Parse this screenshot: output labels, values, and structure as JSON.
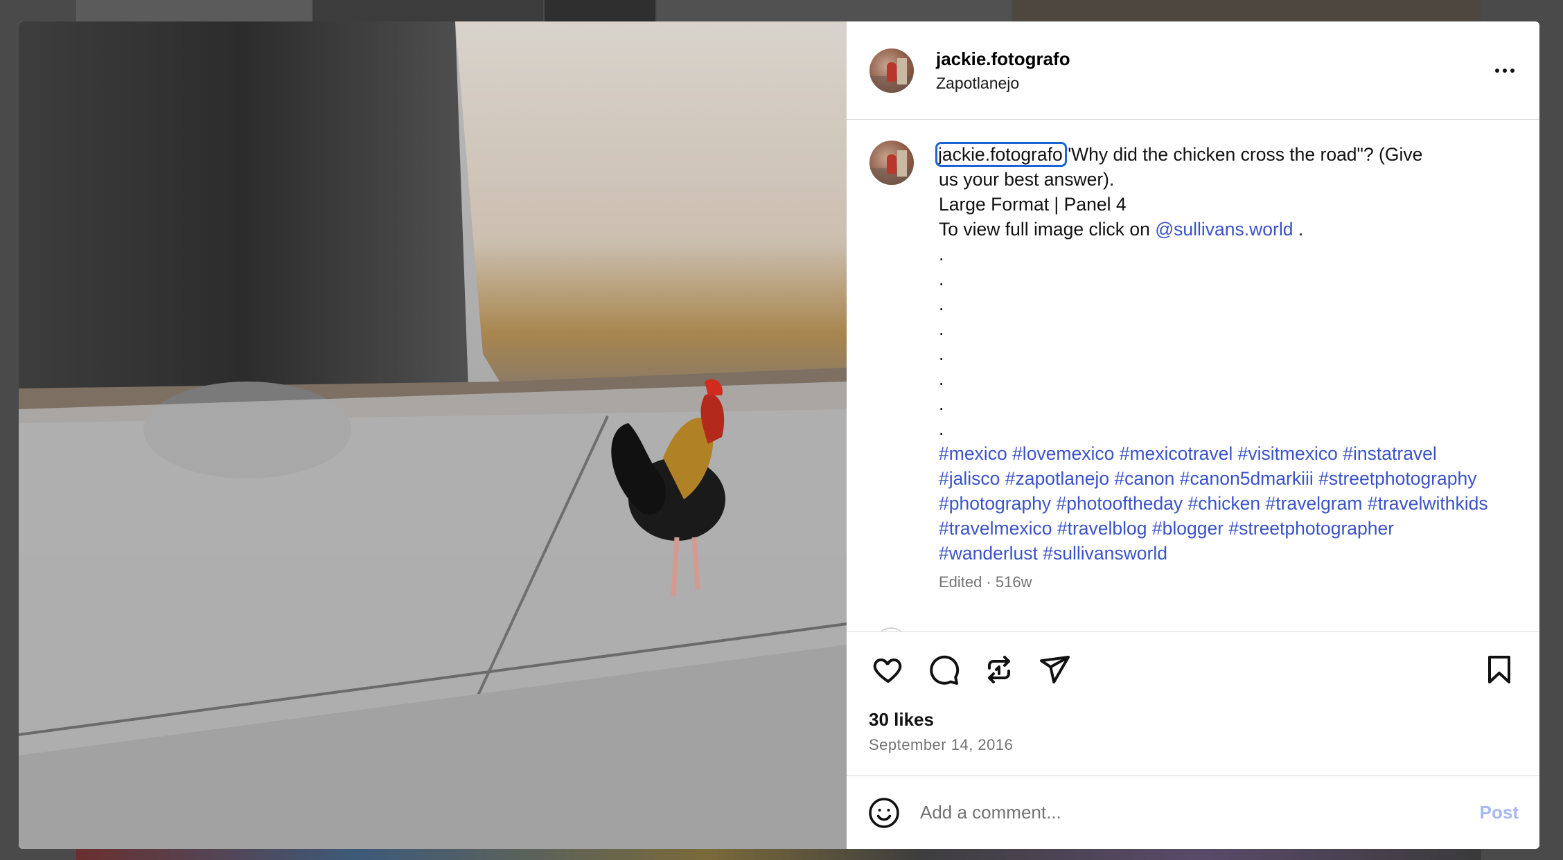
{
  "post": {
    "username": "jackie.fotografo",
    "location": "Zapotlanejo",
    "more_icon": "more-horizontal-icon",
    "caption": {
      "author": "jackie.fotografo",
      "text_line_1": "\"Why did the chicken cross the road\"? (Give",
      "text_line_2": "us your best answer).",
      "line_3": "Large Format | Panel 4",
      "line_4_prefix": "To view full image click on ",
      "mention": "@sullivans.world",
      "line_4_suffix": " .",
      "dots": [
        ".",
        ".",
        ".",
        ".",
        ".",
        ".",
        ".",
        "."
      ],
      "hashtags": [
        "#mexico",
        "#lovemexico",
        "#mexicotravel",
        "#visitmexico",
        "#instatravel",
        "#jalisco",
        "#zapotlanejo",
        "#canon",
        "#canon5dmarkiii",
        "#streetphotography",
        "#photography",
        "#photooftheday",
        "#chicken",
        "#travelgram",
        "#travelwithkids",
        "#travelmexico",
        "#travelblog",
        "#blogger",
        "#streetphotographer",
        "#wanderlust",
        "#sullivansworld"
      ],
      "meta": "Edited · 516w"
    },
    "likes": "30 likes",
    "date": "September 14, 2016",
    "comment_placeholder": "Add a comment...",
    "post_button": "Post"
  },
  "icons": {
    "like": "heart-icon",
    "comment": "comment-icon",
    "repost": "repost-icon",
    "share": "share-icon",
    "save": "bookmark-icon",
    "emoji": "emoji-icon"
  },
  "colors": {
    "link": "#3a53c9",
    "muted": "#737373",
    "post_disabled": "#a5b8f0",
    "focus_outline": "#1d63d6"
  }
}
